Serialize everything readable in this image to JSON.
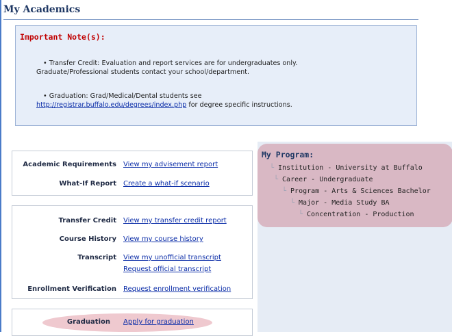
{
  "page": {
    "title": "My Academics"
  },
  "notes": {
    "heading": "Important Note(s):",
    "transfer": {
      "line1": "• Transfer Credit: Evaluation and report services are for undergraduates only.",
      "line2": "Graduate/Professional students contact your school/department."
    },
    "graduation": {
      "line1": "• Graduation: Grad/Medical/Dental students see",
      "link": "http://registrar.buffalo.edu/degrees/index.php",
      "after_link": " for degree specific instructions."
    }
  },
  "advisement": {
    "rows": [
      {
        "label": "Academic Requirements",
        "link": "View my advisement report"
      },
      {
        "label": "What-If Report",
        "link": "Create a what-if scenario"
      }
    ]
  },
  "records": {
    "rows": [
      {
        "label": "Transfer Credit",
        "links": [
          "View my transfer credit report"
        ]
      },
      {
        "label": "Course History",
        "links": [
          "View my course history"
        ]
      },
      {
        "label": "Transcript",
        "links": [
          "View my unofficial transcript",
          "Request official transcript"
        ]
      },
      {
        "label": "Enrollment Verification",
        "links": [
          "Request enrollment verification"
        ]
      }
    ]
  },
  "graduation_card": {
    "label": "Graduation",
    "link": "Apply for graduation"
  },
  "program": {
    "title": "My Program:",
    "items": [
      "Institution - University at Buffalo",
      "Career - Undergraduate",
      "Program - Arts & Sciences Bachelor",
      "Major - Media Study BA",
      "Concentration - Production"
    ]
  },
  "colors": {
    "title": "#1f3864",
    "note_heading": "#c00000",
    "link": "#0b2da8",
    "notes_bg": "#e7eef9",
    "program_bg": "#d9b8c4",
    "highlight": "#efc9cf"
  },
  "icons": {
    "tree_connector": "tree-elbow-icon"
  }
}
